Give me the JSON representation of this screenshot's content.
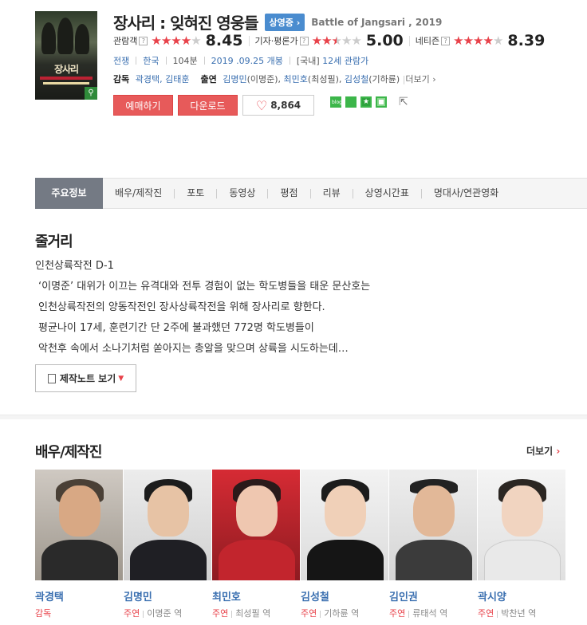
{
  "movie": {
    "title": "장사리 : 잊혀진 영웅들",
    "status_badge": "상영중",
    "english_title": "Battle of Jangsari , 2019",
    "poster_title": "장사리"
  },
  "ratings": [
    {
      "label": "관람객",
      "stars_on": 4,
      "stars_half": 0,
      "score": "8.45"
    },
    {
      "label": "기자·평론가",
      "stars_on": 2,
      "stars_half": 1,
      "score": "5.00"
    },
    {
      "label": "네티즌",
      "stars_on": 4,
      "stars_half": 0,
      "score": "8.39"
    }
  ],
  "info": {
    "genre": "전쟁",
    "country": "한국",
    "runtime": "104분",
    "release": "2019 .09.25 개봉",
    "grade_prefix": "[국내]",
    "grade": "12세 관람가"
  },
  "credits": {
    "director_label": "감독",
    "directors": "곽경택, 김태훈",
    "cast_label": "출연",
    "cast": [
      {
        "name": "김명민",
        "role": "(이명준)"
      },
      {
        "name": "최민호",
        "role": "(최성필)"
      },
      {
        "name": "김성철",
        "role": "(기하륜)"
      }
    ],
    "more": "더보기"
  },
  "buttons": {
    "reserve": "예매하기",
    "download": "다운로드",
    "likes": "8,864"
  },
  "share": {
    "blog": "blog"
  },
  "tabs": [
    "주요정보",
    "배우/제작진",
    "포토",
    "동영상",
    "평점",
    "리뷰",
    "상영시간표",
    "명대사/연관영화"
  ],
  "synopsis": {
    "heading": "줄거리",
    "lines": [
      "인천상륙작전 D-1",
      "‘이명준’ 대위가 이끄는 유격대와 전투 경험이 없는 학도병들을 태운 문산호는",
      "인천상륙작전의 양동작전인 장사상륙작전을 위해 장사리로 향한다.",
      "평균나이 17세, 훈련기간 단 2주에 불과했던 772명 학도병들이",
      "악천후 속에서 소나기처럼 쏟아지는 총알을 맞으며 상륙을 시도하는데…"
    ],
    "note_button": "제작노트 보기"
  },
  "cast_section": {
    "heading": "배우/제작진",
    "more": "더보기",
    "people": [
      {
        "name": "곽경택",
        "role_type": "감독",
        "character": ""
      },
      {
        "name": "김명민",
        "role_type": "주연",
        "character": "이명준 역"
      },
      {
        "name": "최민호",
        "role_type": "주연",
        "character": "최성필 역"
      },
      {
        "name": "김성철",
        "role_type": "주연",
        "character": "기하륜 역"
      },
      {
        "name": "김인권",
        "role_type": "주연",
        "character": "류태석 역"
      },
      {
        "name": "곽시양",
        "role_type": "주연",
        "character": "박찬년 역"
      }
    ]
  },
  "colors": {
    "accent_red": "#e75a5a",
    "star_red": "#e8424a",
    "link_blue": "#3a6fb0",
    "tab_active": "#747a84"
  }
}
